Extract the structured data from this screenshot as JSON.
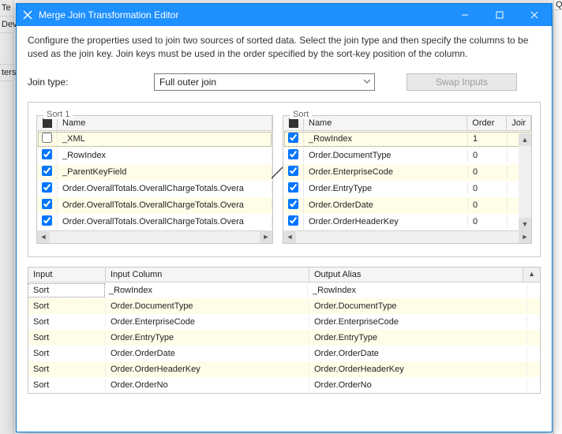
{
  "bgLeft": [
    "Te",
    "Deve",
    "",
    "ters"
  ],
  "bgRight": "Qu",
  "title": "Merge Join Transformation Editor",
  "description": "Configure the properties used to join two sources of sorted data. Select the join type and then specify the columns to be used as the join key. Join keys must be used in the order specified by the sort-key position of the column.",
  "joinTypeLabel": "Join type:",
  "joinTypeValue": "Full outer join",
  "swapLabel": "Swap Inputs",
  "leftPanel": {
    "title": "Sort 1",
    "headers": {
      "name": "Name"
    },
    "rows": [
      {
        "checked": false,
        "name": "_XML"
      },
      {
        "checked": true,
        "name": "_RowIndex"
      },
      {
        "checked": true,
        "name": "_ParentKeyField"
      },
      {
        "checked": true,
        "name": "Order.OverallTotals.OverallChargeTotals.Overa"
      },
      {
        "checked": true,
        "name": "Order.OverallTotals.OverallChargeTotals.Overa"
      },
      {
        "checked": true,
        "name": "Order.OverallTotals.OverallChargeTotals.Overa"
      }
    ]
  },
  "rightPanel": {
    "title": "Sort",
    "headers": {
      "name": "Name",
      "order": "Order",
      "join": "Joir"
    },
    "rows": [
      {
        "checked": true,
        "name": "_RowIndex",
        "order": "1"
      },
      {
        "checked": true,
        "name": "Order.DocumentType",
        "order": "0"
      },
      {
        "checked": true,
        "name": "Order.EnterpriseCode",
        "order": "0"
      },
      {
        "checked": true,
        "name": "Order.EntryType",
        "order": "0"
      },
      {
        "checked": true,
        "name": "Order.OrderDate",
        "order": "0"
      },
      {
        "checked": true,
        "name": "Order.OrderHeaderKey",
        "order": "0"
      }
    ]
  },
  "mapping": {
    "headers": {
      "input": "Input",
      "col": "Input Column",
      "alias": "Output Alias"
    },
    "rows": [
      {
        "input": "Sort",
        "col": "_RowIndex",
        "alias": "_RowIndex"
      },
      {
        "input": "Sort",
        "col": "Order.DocumentType",
        "alias": "Order.DocumentType"
      },
      {
        "input": "Sort",
        "col": "Order.EnterpriseCode",
        "alias": "Order.EnterpriseCode"
      },
      {
        "input": "Sort",
        "col": "Order.EntryType",
        "alias": "Order.EntryType"
      },
      {
        "input": "Sort",
        "col": "Order.OrderDate",
        "alias": "Order.OrderDate"
      },
      {
        "input": "Sort",
        "col": "Order.OrderHeaderKey",
        "alias": "Order.OrderHeaderKey"
      },
      {
        "input": "Sort",
        "col": "Order.OrderNo",
        "alias": "Order.OrderNo"
      }
    ]
  }
}
